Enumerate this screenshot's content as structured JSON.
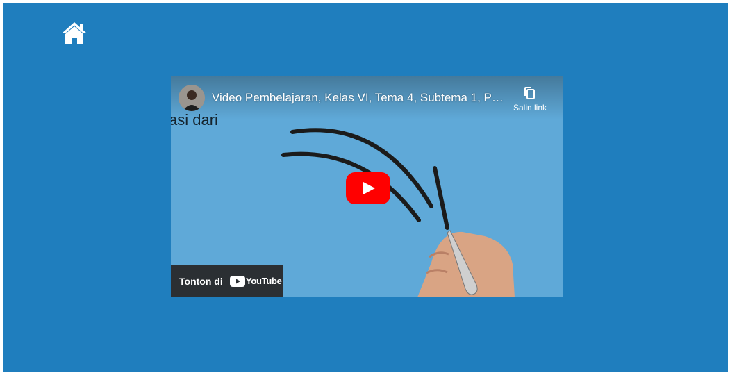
{
  "nav": {
    "home_icon": "home-icon"
  },
  "video": {
    "title": "Video Pembelajaran, Kelas VI, Tema 4, Subtema 1, Pe...",
    "copy_link_label": "Salin link",
    "overlay_text": "asi dari",
    "watch_on_label": "Tonton di",
    "youtube_label": "YouTube"
  },
  "colors": {
    "page_background": "#1f7ebe",
    "video_background": "#5aa8d6",
    "play_button": "#ff0000"
  }
}
